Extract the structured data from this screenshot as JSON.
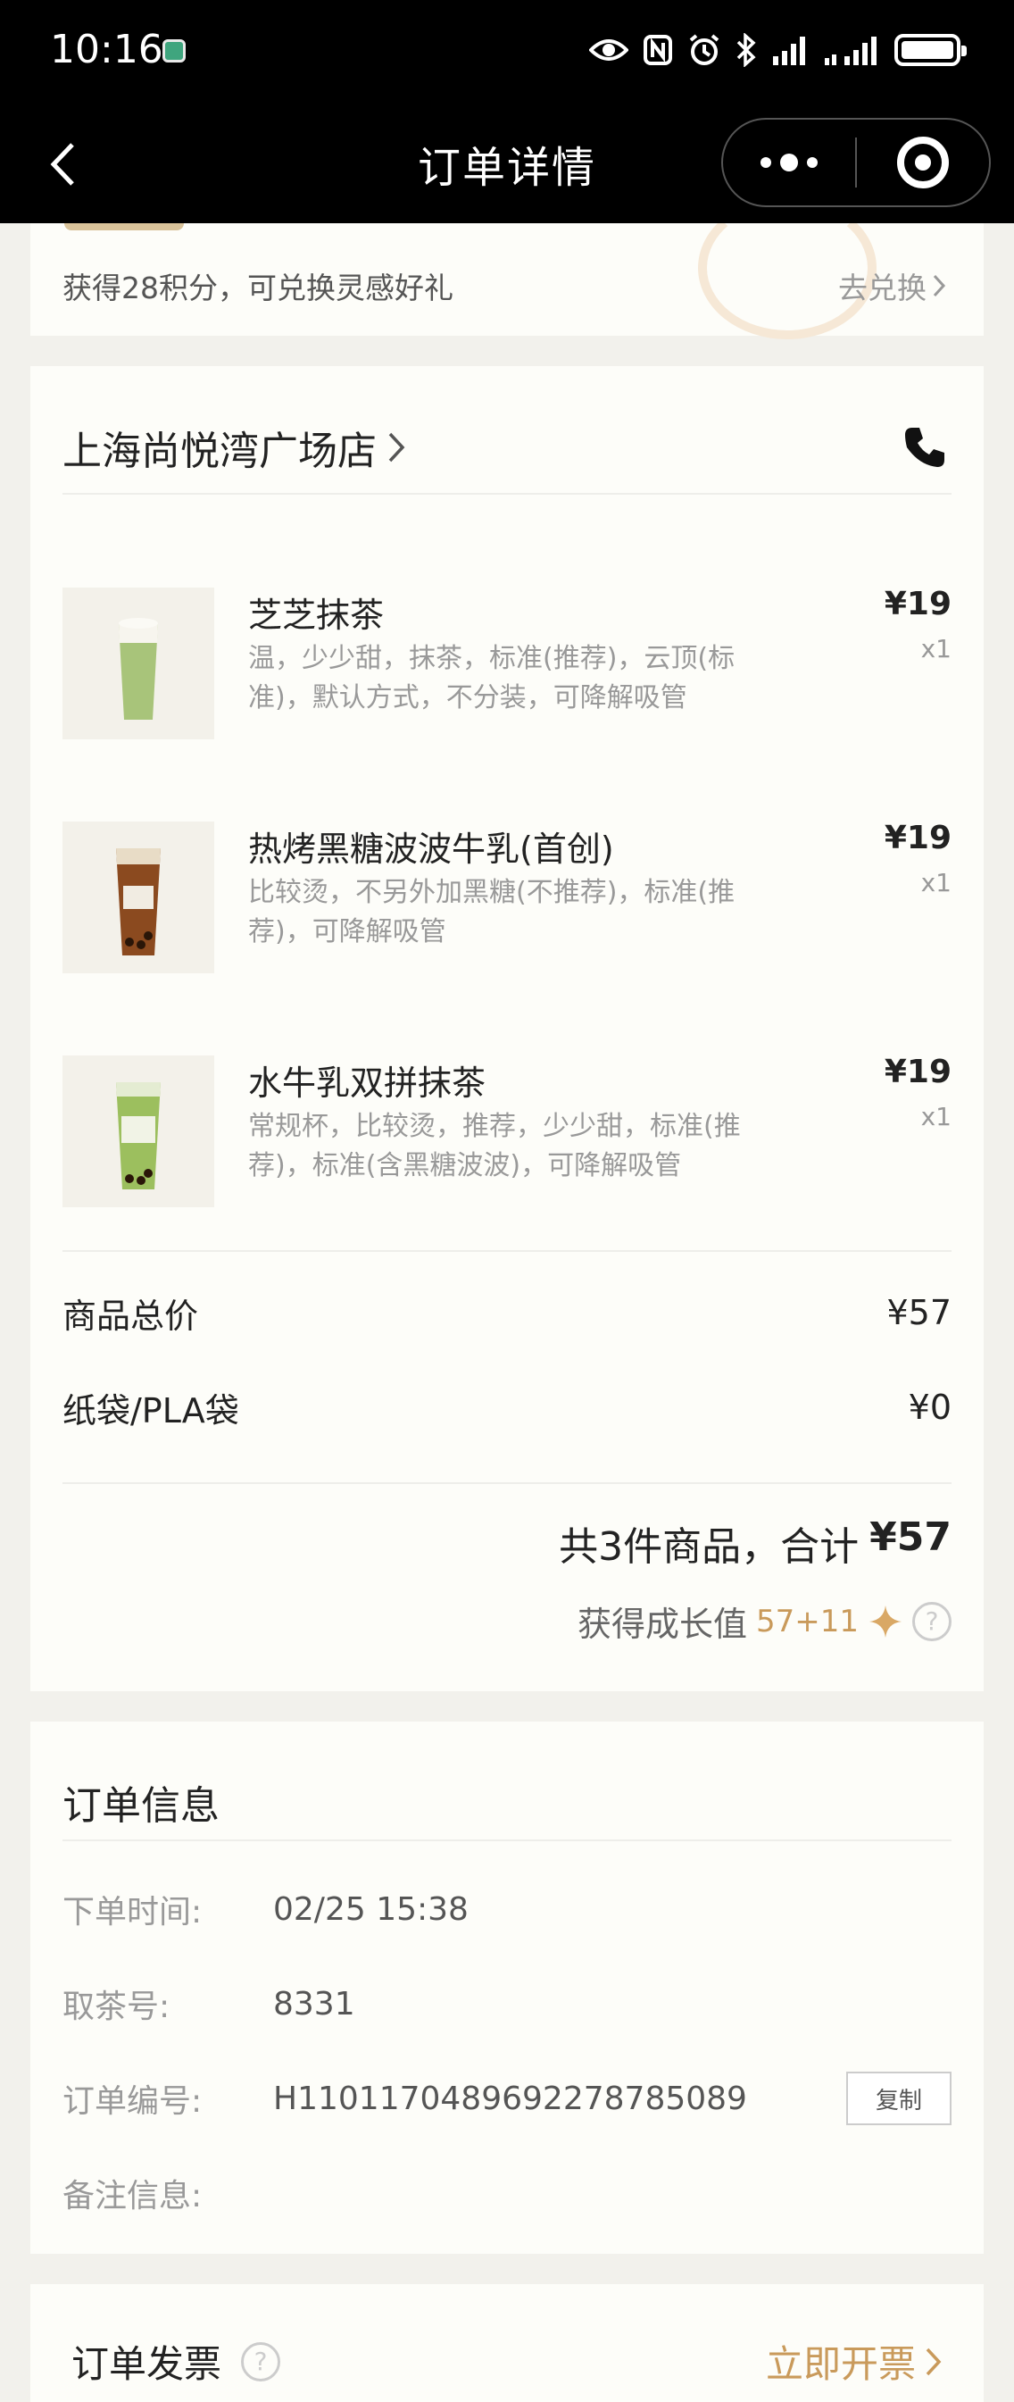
{
  "status_bar": {
    "time": "10:16",
    "icons": [
      "eye-icon",
      "nfc-icon",
      "alarm-icon",
      "bluetooth-icon",
      "signal-icon",
      "signal-icon",
      "battery-icon"
    ]
  },
  "nav": {
    "title": "订单详情"
  },
  "points": {
    "text": "获得28积分，可兑换灵感好礼",
    "link": "去兑换"
  },
  "store": {
    "name": "上海尚悦湾广场店"
  },
  "items": [
    {
      "name": "芝芝抹茶",
      "desc": "温，少少甜，抹茶，标准(推荐)，云顶(标准)，默认方式，不分装，可降解吸管",
      "price": "¥19",
      "qty": "x1",
      "cup_color": "#a8c47a"
    },
    {
      "name": "热烤黑糖波波牛乳(首创)",
      "desc": "比较烫，不另外加黑糖(不推荐)，标准(推荐)，可降解吸管",
      "price": "¥19",
      "qty": "x1",
      "cup_color": "#8b4a1f"
    },
    {
      "name": "水牛乳双拼抹茶",
      "desc": "常规杯，比较烫，推荐，少少甜，标准(推荐)，标准(含黑糖波波)，可降解吸管",
      "price": "¥19",
      "qty": "x1",
      "cup_color": "#9cbf5e"
    }
  ],
  "totals": {
    "goods_label": "商品总价",
    "goods_value": "¥57",
    "bag_label": "纸袋/PLA袋",
    "bag_value": "¥0",
    "summary_prefix": "共3件商品，合计",
    "summary_total": "¥57",
    "growth_label": "获得成长值",
    "growth_value": "57+11"
  },
  "order_info": {
    "title": "订单信息",
    "rows": [
      {
        "label": "下单时间:",
        "value": "02/25 15:38"
      },
      {
        "label": "取茶号:",
        "value": "8331"
      },
      {
        "label": "订单编号:",
        "value": "H1101170489692278785089"
      },
      {
        "label": "备注信息:",
        "value": ""
      }
    ],
    "copy_label": "复制"
  },
  "invoice": {
    "title": "订单发票",
    "link": "立即开票"
  },
  "colors": {
    "accent_gold": "#c99a5b",
    "background": "#f2f1ec",
    "card": "#fdfdf9"
  }
}
